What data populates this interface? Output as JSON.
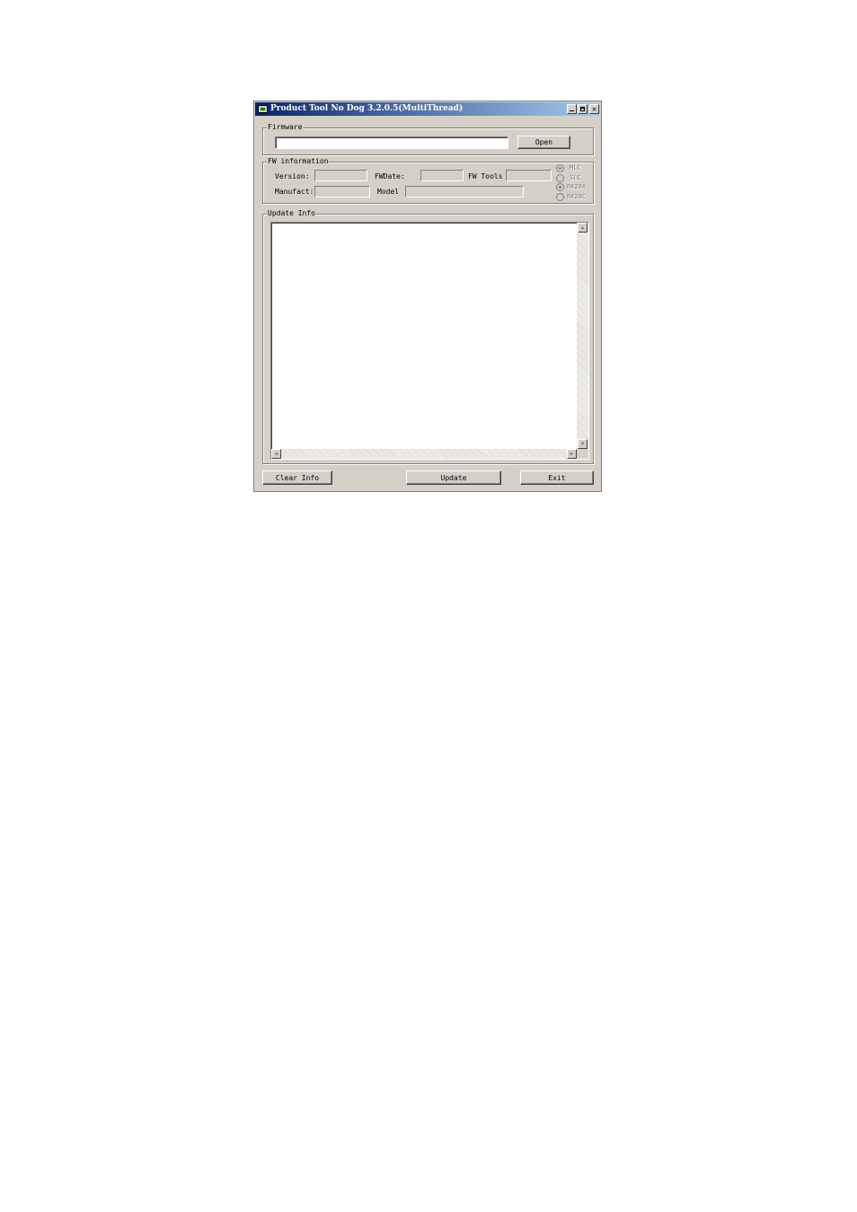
{
  "window": {
    "title": "Product Tool No Dog 3.2.0.5(MultiThread)"
  },
  "firmware": {
    "group_label": "Firmware",
    "path_value": "",
    "open_label": "Open"
  },
  "fw_info": {
    "group_label": "FW information",
    "version_label": "Version:",
    "fwdate_label": "FWDate:",
    "fwtools_label": "FW Tools",
    "manufact_label": "Manufact:",
    "model_label": "Model",
    "version_value": "",
    "fwdate_value": "",
    "fwtools_value": "",
    "manufact_value": "",
    "model_value": "",
    "radios": [
      {
        "label": "MLC",
        "checked": true
      },
      {
        "label": "SLC",
        "checked": false
      },
      {
        "label": "RK28A",
        "checked": true
      },
      {
        "label": "RK28C",
        "checked": false
      }
    ]
  },
  "update_info": {
    "group_label": "Update Info",
    "log_text": ""
  },
  "buttons": {
    "clear_label": "Clear Info",
    "update_label": "Update",
    "exit_label": "Exit"
  }
}
